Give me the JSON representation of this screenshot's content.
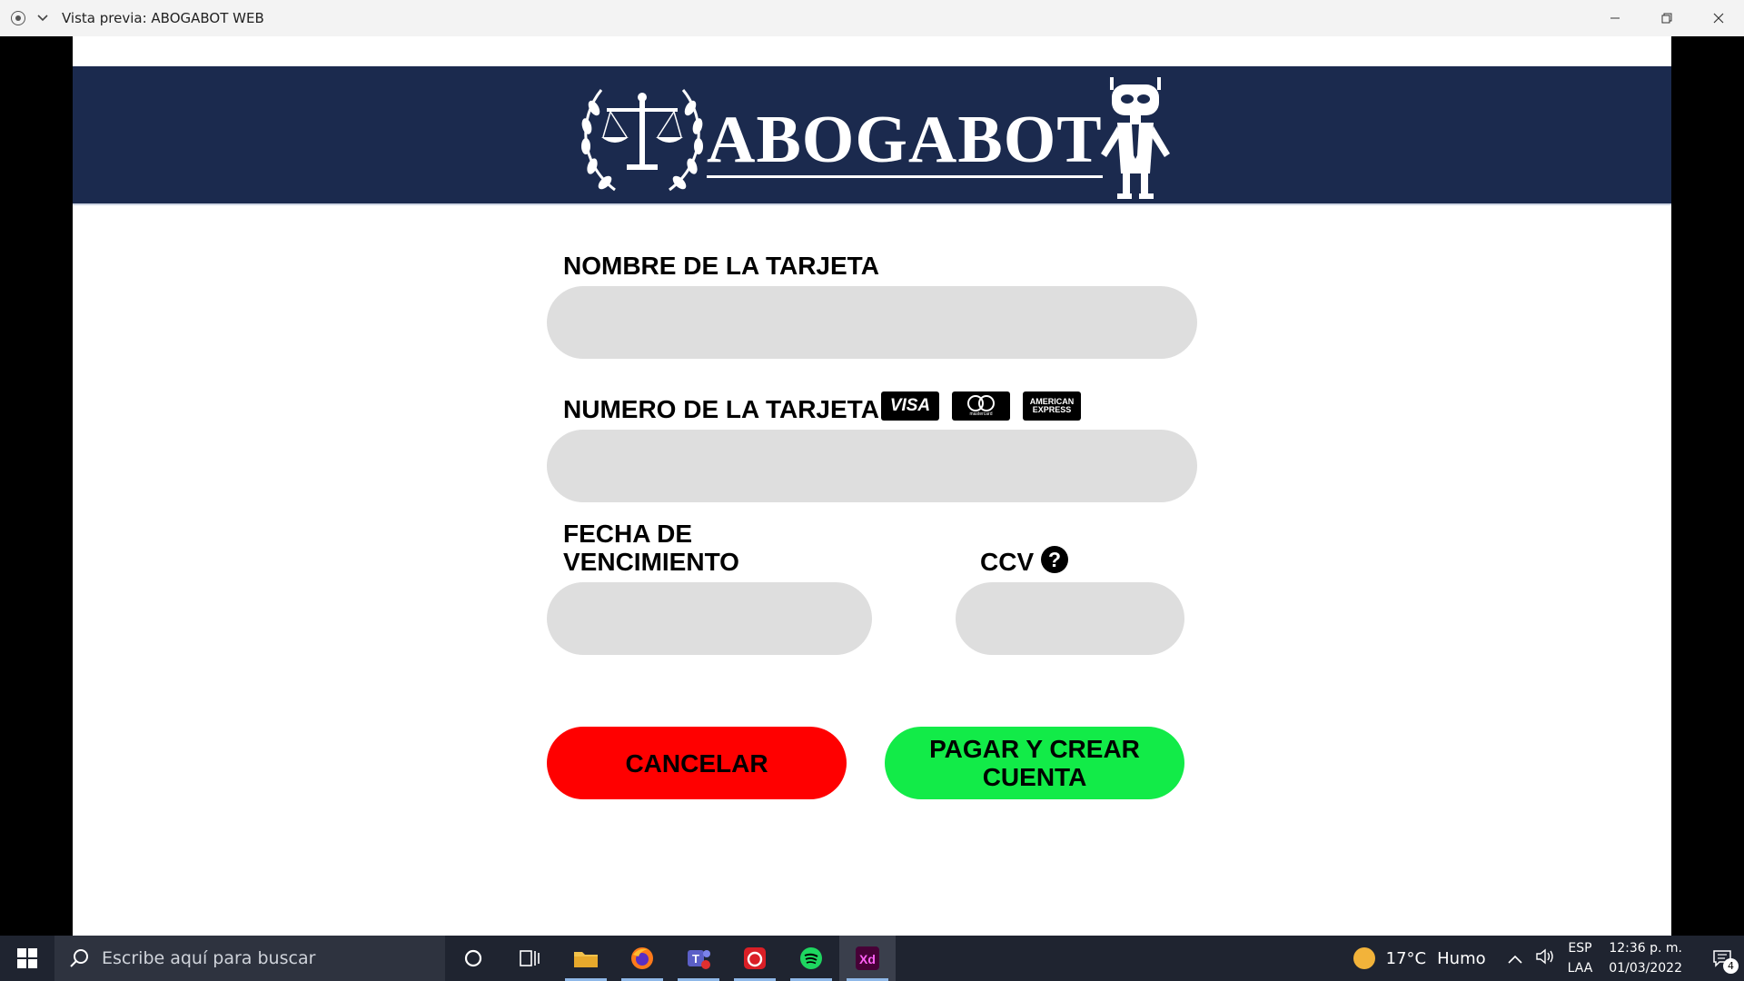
{
  "window": {
    "title": "Vista previa: ABOGABOT WEB"
  },
  "banner": {
    "logo_text": "ABOGABOT"
  },
  "form": {
    "card_name_label": "NOMBRE DE LA TARJETA",
    "card_number_label": "NUMERO DE LA TARJETA",
    "card_brands": [
      "VISA",
      "mastercard",
      "AMERICAN EXPRESS"
    ],
    "expiry_label": "FECHA DE VENCIMIENTO",
    "ccv_label": "CCV",
    "ccv_help_icon": "question-circle-icon",
    "card_name_value": "",
    "card_number_value": "",
    "expiry_value": "",
    "ccv_value": ""
  },
  "buttons": {
    "cancel_label": "CANCELAR",
    "pay_label": "PAGAR Y CREAR CUENTA"
  },
  "colors": {
    "banner": "#1b2a4e",
    "field": "#dedede",
    "cancel": "#ff0000",
    "pay": "#12eb48"
  },
  "taskbar": {
    "search_placeholder": "Escribe aquí para buscar",
    "apps": [
      "cortana-icon",
      "task-view-icon",
      "file-explorer-icon",
      "firefox-icon",
      "teams-icon",
      "creative-cloud-icon",
      "spotify-icon",
      "adobe-xd-icon"
    ],
    "weather_temp": "17°C",
    "weather_desc": "Humo",
    "lang_1": "ESP",
    "lang_2": "LAA",
    "time": "12:36 p. m.",
    "date": "01/03/2022",
    "notification_count": "4"
  }
}
